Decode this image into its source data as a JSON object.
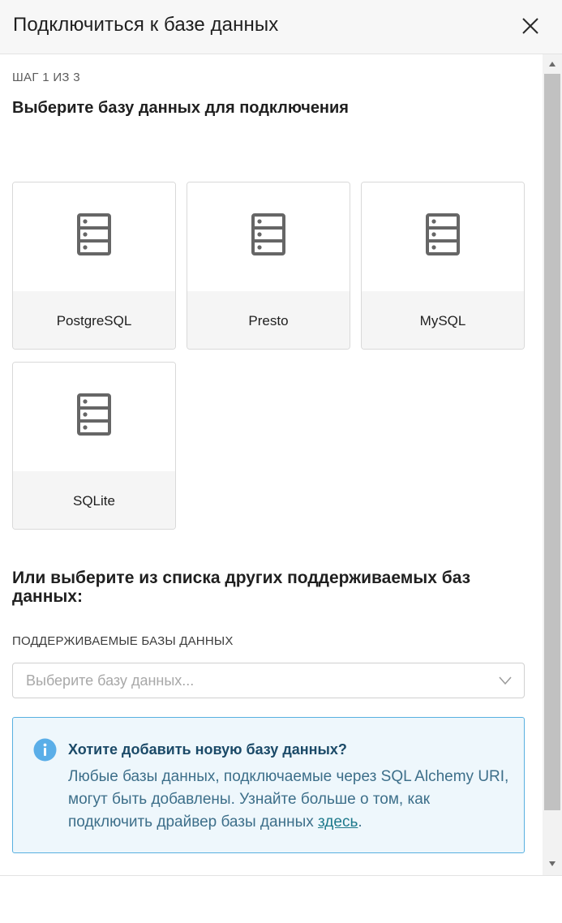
{
  "modal": {
    "title": "Подключиться к базе данных"
  },
  "step": {
    "label": "ШАГ 1 ИЗ 3",
    "title": "Выберите базу данных для подключения"
  },
  "databases": [
    {
      "label": "PostgreSQL",
      "icon": "database-server-icon"
    },
    {
      "label": "Presto",
      "icon": "database-server-icon"
    },
    {
      "label": "MySQL",
      "icon": "database-server-icon"
    },
    {
      "label": "SQLite",
      "icon": "database-server-icon"
    }
  ],
  "other": {
    "title": "Или выберите из списка других поддерживаемых баз данных:",
    "select_label": "ПОДДЕРЖИВАЕМЫЕ БАЗЫ ДАННЫХ",
    "select_placeholder": "Выберите базу данных..."
  },
  "info": {
    "title": "Хотите добавить новую базу данных?",
    "text": "Любые базы данных, подключаемые через SQL Alchemy URI, могут быть добавлены. Узнайте больше о том, как подключить драйвер базы данных ",
    "link": "здесь",
    "text_end": ".",
    "icon": "info-icon"
  },
  "colors": {
    "info_border": "#58b0e0",
    "info_background": "#eef7fc",
    "info_icon": "#5aaee8",
    "link": "#1f7a8c"
  }
}
